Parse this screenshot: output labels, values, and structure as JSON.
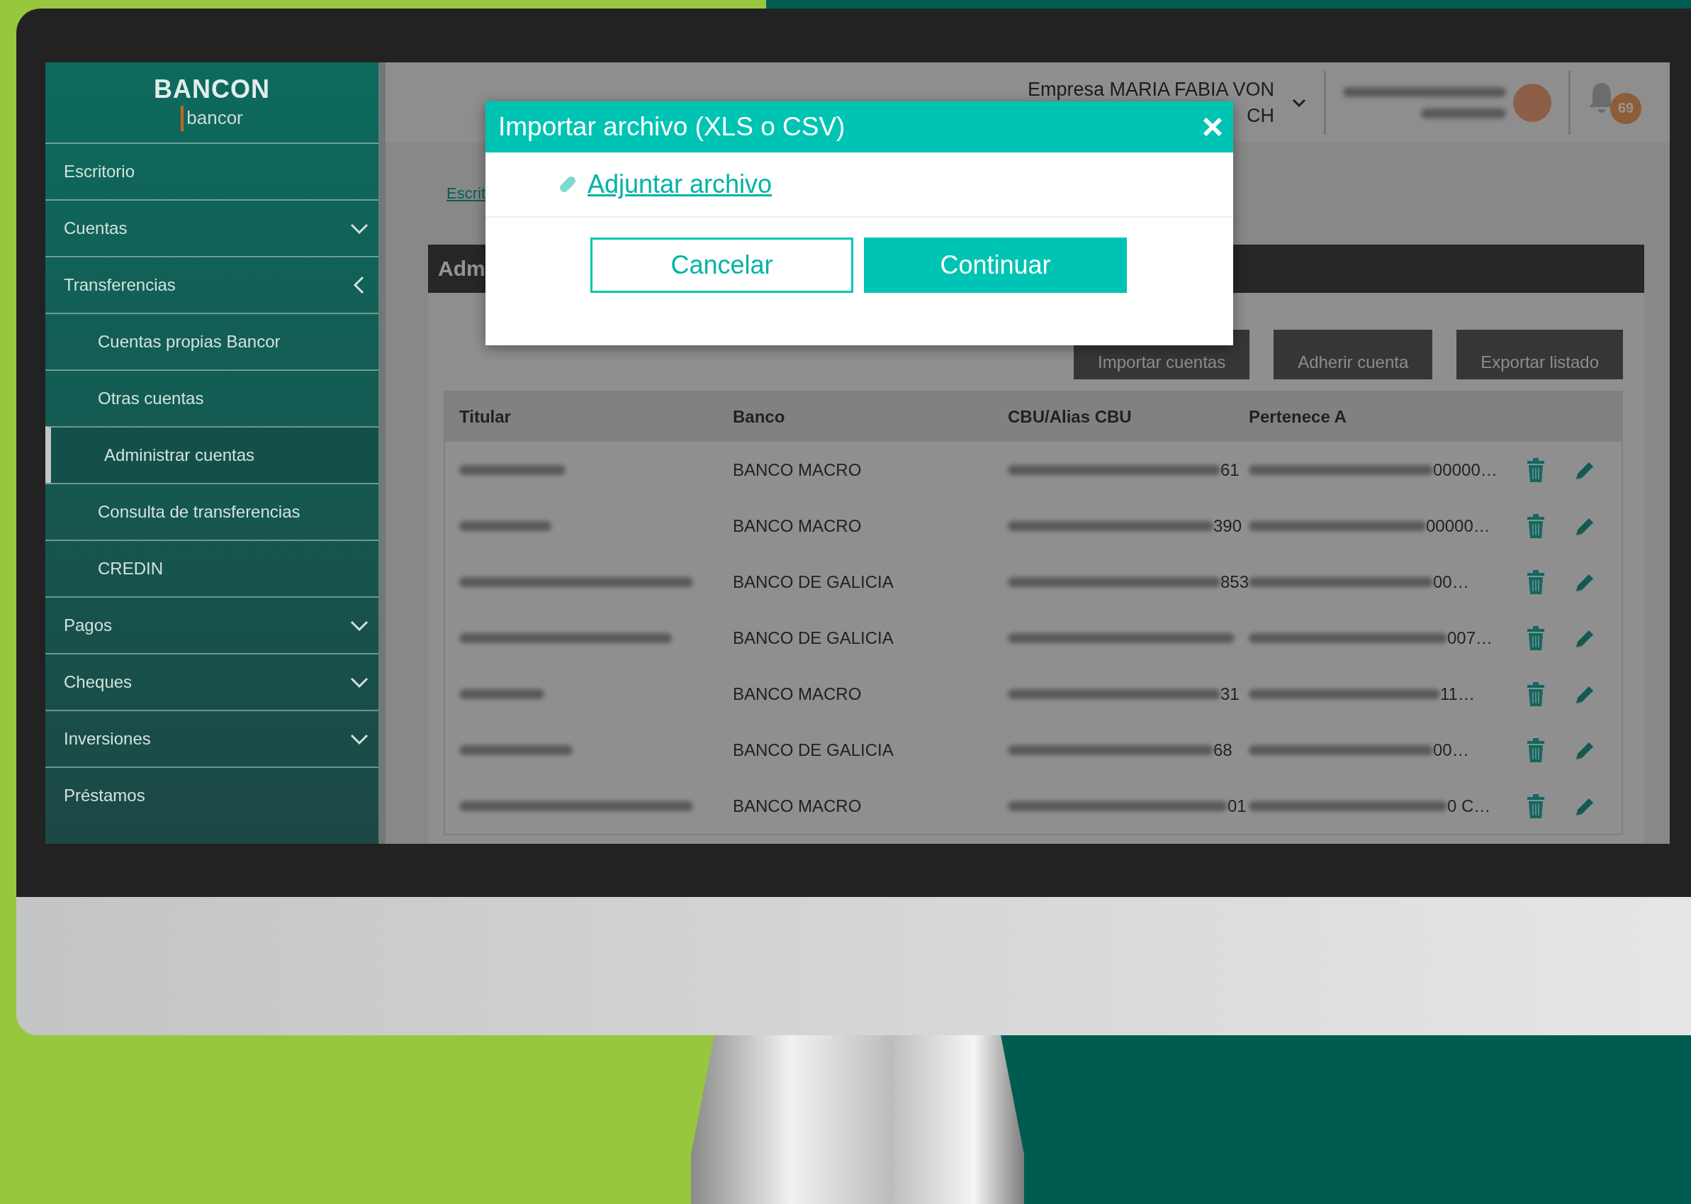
{
  "logo": {
    "brand": "BANCON",
    "sub": "bancor"
  },
  "sidebar": {
    "items": [
      {
        "label": "Escritorio",
        "kind": "link",
        "selected": false
      },
      {
        "label": "Cuentas",
        "kind": "group",
        "expanded": false,
        "selected": false
      },
      {
        "label": "Transferencias",
        "kind": "group",
        "expanded": true,
        "selected": false,
        "children": [
          {
            "label": "Cuentas propias Bancor",
            "kind": "link",
            "selected": false
          },
          {
            "label": "Otras cuentas",
            "kind": "link",
            "selected": false
          },
          {
            "label": "Administrar cuentas",
            "kind": "link",
            "selected": true
          },
          {
            "label": "Consulta de transferencias",
            "kind": "link",
            "selected": false
          },
          {
            "label": "CREDIN",
            "kind": "link",
            "selected": false
          }
        ]
      },
      {
        "label": "Pagos",
        "kind": "group",
        "expanded": false,
        "selected": false
      },
      {
        "label": "Cheques",
        "kind": "group",
        "expanded": false,
        "selected": false
      },
      {
        "label": "Inversiones",
        "kind": "group",
        "expanded": false,
        "selected": false
      },
      {
        "label": "Préstamos",
        "kind": "link",
        "selected": false
      }
    ]
  },
  "header": {
    "company_lines": [
      "Empresa MARIA FABIA VON",
      "CH"
    ],
    "notification_count": "69"
  },
  "breadcrumb": "Escrit",
  "panel": {
    "title": "Adm",
    "buttons": [
      "Importar cuentas",
      "Adherir cuenta",
      "Exportar listado"
    ]
  },
  "table": {
    "columns": [
      "Titular",
      "Banco",
      "CBU/Alias CBU",
      "Pertenece A"
    ],
    "rows": [
      {
        "banco": "BANCO MACRO",
        "cbu": "61",
        "pertenece": "00000…"
      },
      {
        "banco": "BANCO MACRO",
        "cbu": "390",
        "pertenece": "00000…"
      },
      {
        "banco": "BANCO DE GALICIA",
        "cbu": "853",
        "pertenece": "00…"
      },
      {
        "banco": "BANCO DE GALICIA",
        "pertenece": "007…"
      },
      {
        "banco": "BANCO MACRO",
        "cbu": "31",
        "pertenece": "11…"
      },
      {
        "banco": "BANCO DE GALICIA",
        "cbu": "68",
        "pertenece": "00…"
      },
      {
        "banco": "BANCO MACRO",
        "cbu": "01",
        "pertenece": "0 C…"
      }
    ]
  },
  "modal": {
    "title": "Importar archivo (XLS o CSV)",
    "link": "Adjuntar archivo",
    "buttons": [
      {
        "label": "Cancelar",
        "kind": "secondary"
      },
      {
        "label": "Continuar",
        "kind": "primary"
      }
    ]
  }
}
